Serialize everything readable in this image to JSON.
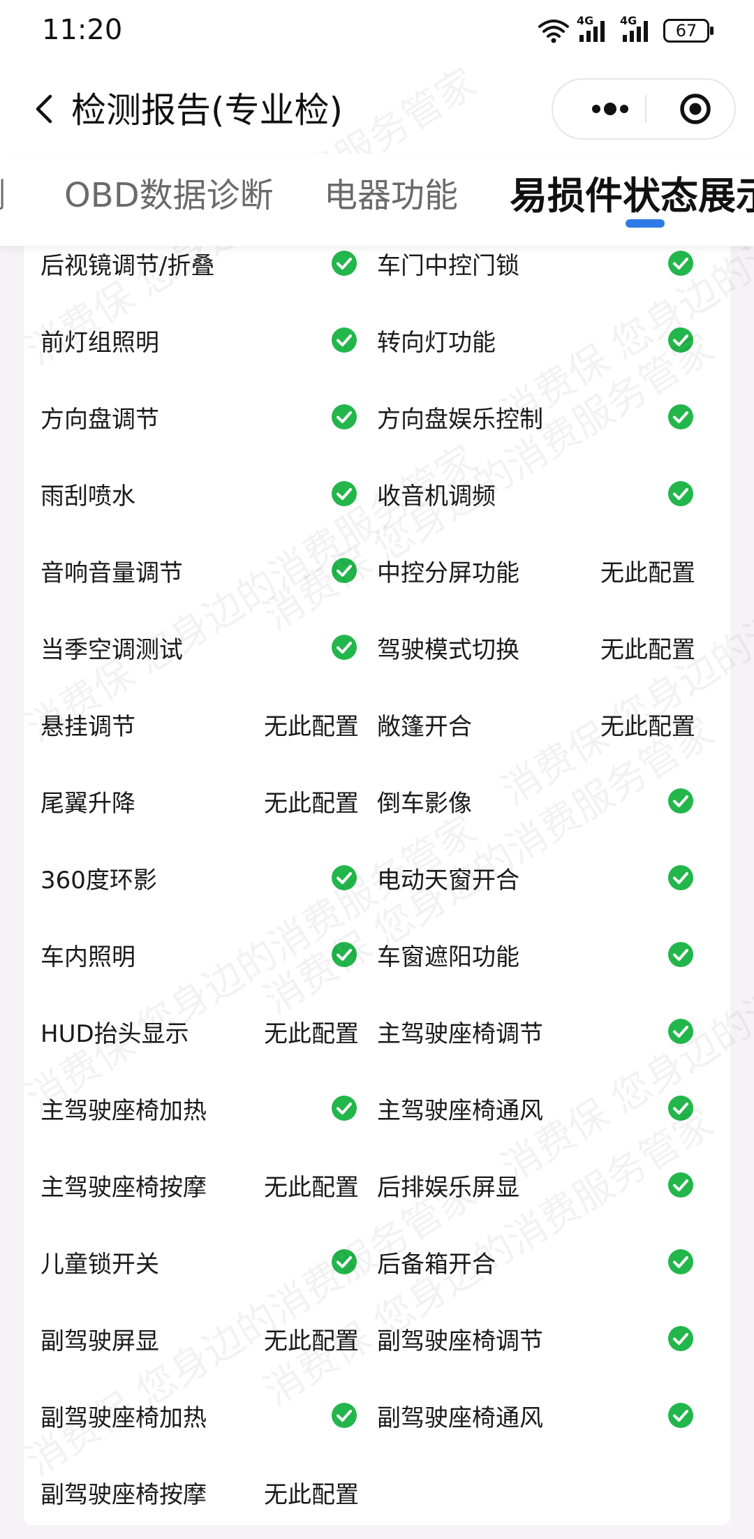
{
  "status_bar": {
    "time": "11:20",
    "network_1": "4G",
    "network_2": "4G",
    "battery": "67"
  },
  "nav": {
    "title": "检测报告(专业检)"
  },
  "tabs": [
    {
      "label": "测"
    },
    {
      "label": "OBD数据诊断"
    },
    {
      "label": "电器功能"
    },
    {
      "label": "易损件状态展示"
    }
  ],
  "active_tab": "易损件状态展示",
  "colors": {
    "check_green": "#22b64b",
    "tab_indicator": "#2f7ae5"
  },
  "items": [
    [
      {
        "label": "后视镜调节/折叠",
        "status": "ok"
      },
      {
        "label": "车门中控门锁",
        "status": "ok"
      }
    ],
    [
      {
        "label": "前灯组照明",
        "status": "ok"
      },
      {
        "label": "转向灯功能",
        "status": "ok"
      }
    ],
    [
      {
        "label": "方向盘调节",
        "status": "ok"
      },
      {
        "label": "方向盘娱乐控制",
        "status": "ok"
      }
    ],
    [
      {
        "label": "雨刮喷水",
        "status": "ok"
      },
      {
        "label": "收音机调频",
        "status": "ok"
      }
    ],
    [
      {
        "label": "音响音量调节",
        "status": "ok"
      },
      {
        "label": "中控分屏功能",
        "status": "text",
        "value": "无此配置"
      }
    ],
    [
      {
        "label": "当季空调测试",
        "status": "ok"
      },
      {
        "label": "驾驶模式切换",
        "status": "text",
        "value": "无此配置"
      }
    ],
    [
      {
        "label": "悬挂调节",
        "status": "text",
        "value": "无此配置"
      },
      {
        "label": "敞篷开合",
        "status": "text",
        "value": "无此配置"
      }
    ],
    [
      {
        "label": "尾翼升降",
        "status": "text",
        "value": "无此配置"
      },
      {
        "label": "倒车影像",
        "status": "ok"
      }
    ],
    [
      {
        "label": "360度环影",
        "status": "ok"
      },
      {
        "label": "电动天窗开合",
        "status": "ok"
      }
    ],
    [
      {
        "label": "车内照明",
        "status": "ok"
      },
      {
        "label": "车窗遮阳功能",
        "status": "ok"
      }
    ],
    [
      {
        "label": "HUD抬头显示",
        "status": "text",
        "value": "无此配置"
      },
      {
        "label": "主驾驶座椅调节",
        "status": "ok"
      }
    ],
    [
      {
        "label": "主驾驶座椅加热",
        "status": "ok"
      },
      {
        "label": "主驾驶座椅通风",
        "status": "ok"
      }
    ],
    [
      {
        "label": "主驾驶座椅按摩",
        "status": "text",
        "value": "无此配置"
      },
      {
        "label": "后排娱乐屏显",
        "status": "ok"
      }
    ],
    [
      {
        "label": "儿童锁开关",
        "status": "ok"
      },
      {
        "label": "后备箱开合",
        "status": "ok"
      }
    ],
    [
      {
        "label": "副驾驶屏显",
        "status": "text",
        "value": "无此配置"
      },
      {
        "label": "副驾驶座椅调节",
        "status": "ok"
      }
    ],
    [
      {
        "label": "副驾驶座椅加热",
        "status": "ok"
      },
      {
        "label": "副驾驶座椅通风",
        "status": "ok"
      }
    ],
    [
      {
        "label": "副驾驶座椅按摩",
        "status": "text",
        "value": "无此配置"
      },
      null
    ]
  ],
  "watermark": {
    "text": "消费保 您身边的消费服务管家"
  }
}
